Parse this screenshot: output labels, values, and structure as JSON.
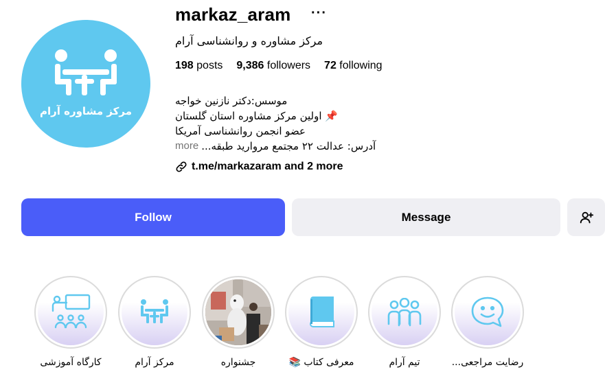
{
  "profile": {
    "username": "markaz_aram",
    "full_name": "مرکز مشاوره و روانشناسی آرام",
    "avatar_text": "مرکز مشاوره آرام",
    "more_icon": "more-dots-icon"
  },
  "stats": {
    "posts_count": "198",
    "posts_label": "posts",
    "followers_count": "9,386",
    "followers_label": "followers",
    "following_count": "72",
    "following_label": "following"
  },
  "bio": {
    "line1": "موسس:دکتر نازنین خواجه",
    "line2": "اولین مرکز مشاوره استان گلستان",
    "line2_emoji": "📌",
    "line3": "عضو انجمن روانشناسی آمریکا",
    "line4": "آدرس: عدالت ۲۲ مجتمع مروارید طبقه...",
    "more_label": "more"
  },
  "links": {
    "text": "t.me/markazaram and 2 more",
    "icon": "link-icon"
  },
  "actions": {
    "follow_label": "Follow",
    "message_label": "Message",
    "add_user_icon": "add-user-icon"
  },
  "colors": {
    "follow_bg": "#4a5df9",
    "avatar_bg": "#5fc8ef",
    "icon_accent": "#5fc8ef"
  },
  "highlights": [
    {
      "label": "کارگاه آموزشی",
      "icon": "workshop-icon"
    },
    {
      "label": "مرکز آرام",
      "icon": "center-logo-icon"
    },
    {
      "label": "جشنواره",
      "icon": "festival-photo"
    },
    {
      "label": "معرفی کتاب 📚",
      "icon": "book-icon"
    },
    {
      "label": "تیم آرام",
      "icon": "team-icon"
    },
    {
      "label": "رضایت مراجعی...",
      "icon": "chat-smile-icon"
    }
  ]
}
